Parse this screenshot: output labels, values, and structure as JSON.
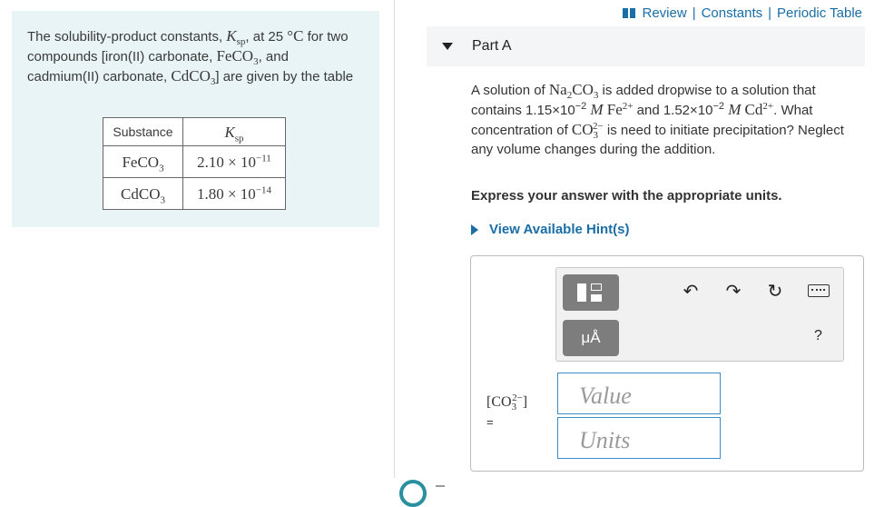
{
  "intro": {
    "text_a": "The solubility-product constants, ",
    "ksp_symbol": "K",
    "ksp_sub": "sp",
    "text_b": ", at 25 ",
    "degree_c": "°C",
    "text_c": " for two compounds [iron(II) carbonate, ",
    "fe_formula": "FeCO",
    "fe_sub": "3",
    "text_d": ", and cadmium(II) carbonate, ",
    "cd_formula": "CdCO",
    "cd_sub": "3",
    "text_e": "] are given by the table"
  },
  "table": {
    "headers": [
      "Substance",
      "Ksp"
    ],
    "header_ksp_main": "K",
    "header_ksp_sub": "sp",
    "rows": [
      {
        "substance": "FeCO",
        "substance_sub": "3",
        "mantissa": "2.10 × 10",
        "exponent": "−11"
      },
      {
        "substance": "CdCO",
        "substance_sub": "3",
        "mantissa": "1.80 × 10",
        "exponent": "−14"
      }
    ]
  },
  "top_links": {
    "review": "Review",
    "constants": "Constants",
    "periodic_table": "Periodic Table",
    "separator": "|"
  },
  "part": {
    "label": "Part A"
  },
  "question": {
    "t1": "A solution of ",
    "na_formula": "Na",
    "na_sub": "2",
    "na_rest": "CO",
    "na_sub2": "3",
    "t2": " is added dropwise to a solution that contains 1.15×10",
    "exp1": "−2",
    "t3": " ",
    "molar1": "M",
    "fe_ion": "Fe",
    "fe_charge": "2+",
    "t4": " and 1.52×10",
    "exp2": "−2",
    "t5": " ",
    "molar2": "M",
    "cd_ion": "Cd",
    "cd_charge": "2+",
    "t6": ". What concentration of ",
    "co3": "CO",
    "co3_sub": "3",
    "co3_charge": "2−",
    "t7": " is need to initiate precipitation? Neglect any volume changes during the addition."
  },
  "express": "Express your answer with the appropriate units.",
  "hint_label": "View Available Hint(s)",
  "toolbar": {
    "units_label": "μÅ",
    "undo": "↶",
    "redo": "↷",
    "reset": "↻",
    "help": "?"
  },
  "answer": {
    "lhs_main": "[CO",
    "lhs_sub": "3",
    "lhs_charge": "2−",
    "lhs_close": "]",
    "equals": "=",
    "value_placeholder": "Value",
    "units_placeholder": "Units"
  }
}
